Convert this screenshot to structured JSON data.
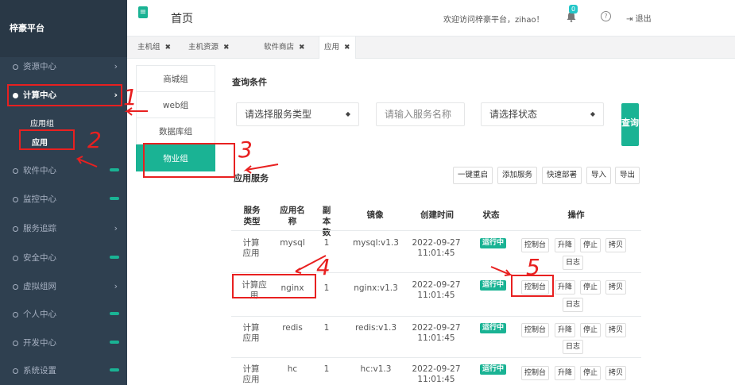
{
  "brand": "梓豪平台",
  "sidebar": {
    "items": [
      {
        "label": "资源中心"
      },
      {
        "label": "计算中心"
      },
      {
        "label": "软件中心"
      },
      {
        "label": "监控中心"
      },
      {
        "label": "服务追踪"
      },
      {
        "label": "安全中心"
      },
      {
        "label": "虚拟组网"
      },
      {
        "label": "个人中心"
      },
      {
        "label": "开发中心"
      },
      {
        "label": "系统设置"
      }
    ],
    "sub_items": [
      {
        "label": "应用组"
      },
      {
        "label": "应用"
      }
    ]
  },
  "topbar": {
    "title": "首页",
    "welcome": "欢迎访问梓豪平台，zihao！",
    "notification_count": "0",
    "help": "?",
    "logout": "退出"
  },
  "tabs": [
    {
      "label": "主机组"
    },
    {
      "label": "主机资源"
    },
    {
      "label": "软件商店"
    },
    {
      "label": "应用"
    }
  ],
  "tab_close": "✖",
  "groups": [
    {
      "label": "商城组"
    },
    {
      "label": "web组"
    },
    {
      "label": "数据库组"
    },
    {
      "label": "物业组"
    }
  ],
  "query": {
    "title": "查询条件",
    "service_type": "请选择服务类型",
    "service_name_placeholder": "请输入服务名称",
    "status": "请选择状态",
    "search_btn": "查询"
  },
  "services": {
    "title": "应用服务",
    "toolbar": [
      {
        "label": "一键重启"
      },
      {
        "label": "添加服务"
      },
      {
        "label": "快速部署"
      },
      {
        "label": "导入"
      },
      {
        "label": "导出"
      }
    ],
    "headers": [
      "服务类型",
      "应用名称",
      "副本数",
      "镜像",
      "创建时间",
      "状态",
      "操作"
    ],
    "rows": [
      {
        "type": "计算应用",
        "name": "mysql",
        "replicas": "1",
        "image": "mysql:v1.3",
        "created": "2022-09-27 11:01:45",
        "status": "运行中"
      },
      {
        "type": "计算应用",
        "name": "nginx",
        "replicas": "1",
        "image": "nginx:v1.3",
        "created": "2022-09-27 11:01:45",
        "status": "运行中"
      },
      {
        "type": "计算应用",
        "name": "redis",
        "replicas": "1",
        "image": "redis:v1.3",
        "created": "2022-09-27 11:01:45",
        "status": "运行中"
      },
      {
        "type": "计算应用",
        "name": "hc",
        "replicas": "1",
        "image": "hc:v1.3",
        "created": "2022-09-27 11:01:45",
        "status": "运行中"
      }
    ],
    "actions": {
      "console": "控制台",
      "upgrade": "升降",
      "stop": "停止",
      "copy": "拷贝",
      "log": "日志"
    }
  },
  "annotations": [
    "1",
    "2",
    "3",
    "4",
    "5"
  ],
  "colors": {
    "sidebar_bg": "#2f4050",
    "accent": "#1ab394",
    "annotation": "#e82020"
  }
}
